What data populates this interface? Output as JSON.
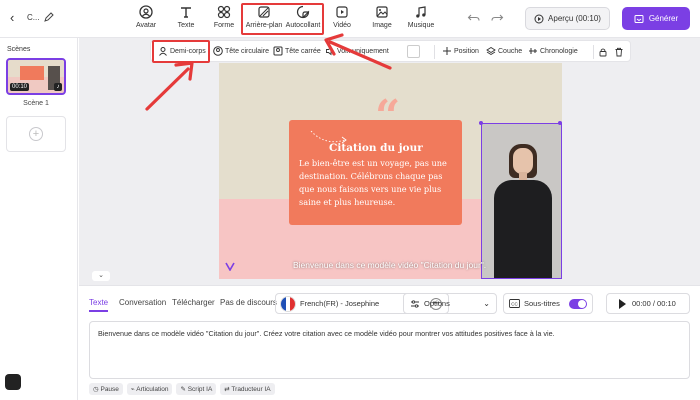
{
  "project": {
    "name": "C..."
  },
  "toolbar": {
    "items": [
      {
        "label": "Avatar",
        "icon": "avatar-icon"
      },
      {
        "label": "Texte",
        "icon": "text-icon"
      },
      {
        "label": "Forme",
        "icon": "shape-icon"
      },
      {
        "label": "Arrière-plan",
        "icon": "background-icon"
      },
      {
        "label": "Autocollant",
        "icon": "sticker-icon"
      },
      {
        "label": "Vidéo",
        "icon": "video-icon"
      },
      {
        "label": "Image",
        "icon": "image-icon"
      },
      {
        "label": "Musique",
        "icon": "music-icon"
      }
    ],
    "preview_label": "Aperçu (00:10)",
    "generate_label": "Générer"
  },
  "scenes": {
    "title": "Scènes",
    "items": [
      {
        "label": "Scène 1",
        "duration": "00:10"
      }
    ]
  },
  "context_bar": {
    "items": [
      {
        "label": "Demi-corps",
        "icon": "half-body-icon"
      },
      {
        "label": "Tête circulaire",
        "icon": "circle-head-icon"
      },
      {
        "label": "Tête carrée",
        "icon": "square-head-icon"
      },
      {
        "label": "Voix uniquement",
        "icon": "voice-only-icon"
      }
    ],
    "right_items": [
      {
        "label": "Position",
        "icon": "move-icon"
      },
      {
        "label": "Couche",
        "icon": "layers-icon"
      },
      {
        "label": "Chronologie",
        "icon": "timeline-icon"
      }
    ]
  },
  "video": {
    "quote_title": "Citation du jour",
    "quote_body": "Le bien-être est un voyage, pas une destination. Célébrons chaque pas que nous faisons vers une vie plus saine et plus heureuse.",
    "subtitle": "Bienvenue dans ce modèle vidéo \"Citation du jour\".",
    "colors": {
      "top": "#e4decd",
      "bottom": "#f7c5c4",
      "card": "#f17a5c",
      "accent": "#7b3fe4"
    }
  },
  "panel": {
    "tabs": [
      "Texte",
      "Conversation",
      "Télécharger",
      "Pas de discours"
    ],
    "active_tab": "Texte",
    "voice": "French(FR) - Josephine",
    "options_label": "Options",
    "subtitles_label": "Sous-titres",
    "time": "00:00 / 00:10",
    "script_text": "Bienvenue dans ce modèle vidéo \"Citation du jour\". Créez votre citation avec ce modèle vidéo pour montrer vos attitudes positives face à la vie.",
    "chips": [
      "Pause",
      "Articulation",
      "Script IA",
      "Traducteur IA"
    ]
  }
}
